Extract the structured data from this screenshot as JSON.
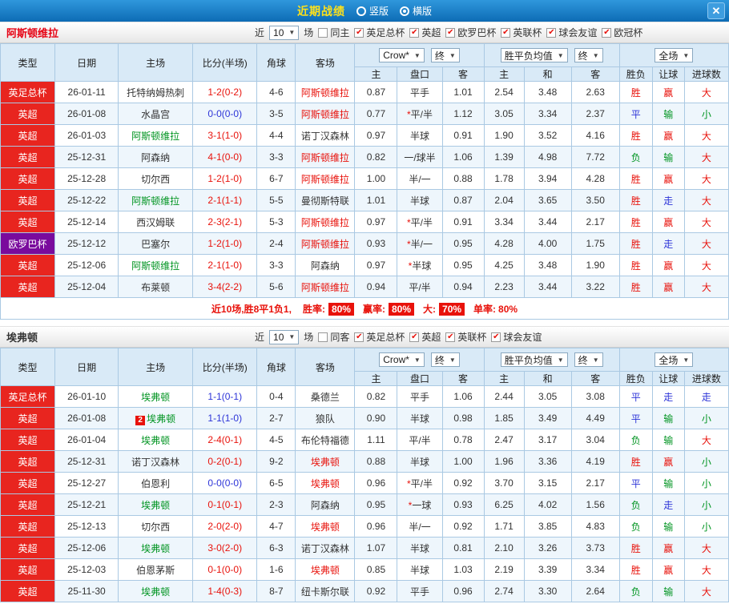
{
  "topbar": {
    "title": "近期战绩",
    "radios": [
      {
        "label": "竖版",
        "selected": false
      },
      {
        "label": "横版",
        "selected": true
      }
    ],
    "close_glyph": "✕"
  },
  "columns": {
    "main": [
      "类型",
      "日期",
      "主场",
      "比分(半场)",
      "角球",
      "客场"
    ],
    "sub": [
      "主",
      "盘口",
      "客",
      "主",
      "和",
      "客",
      "胜负",
      "让球",
      "进球数"
    ]
  },
  "odds_header": {
    "crown": "Crow*",
    "final": "终",
    "avg": "胜平负均值",
    "full": "全场"
  },
  "colors": {
    "red": "#e8120b",
    "green": "#009421",
    "blue": "#2d34d8",
    "black": "#333333",
    "league_red": "#e8251f",
    "league_purple": "#7a0b9d",
    "summary_red": "#e8120b",
    "check_red": "#e8120b",
    "header_blue_bg": "#d9eaf7",
    "topbar_blue": "#1a7fc4",
    "title_yellow": "#ffe11a"
  },
  "sections": [
    {
      "team": "阿斯顿维拉",
      "team_color": "#e60012",
      "filter": {
        "near_label": "近",
        "count": "10",
        "games_label": "场",
        "checkboxes": [
          {
            "label": "同主",
            "checked": false
          },
          {
            "label": "英足总杯",
            "checked": true
          },
          {
            "label": "英超",
            "checked": true
          },
          {
            "label": "欧罗巴杯",
            "checked": true
          },
          {
            "label": "英联杯",
            "checked": true
          },
          {
            "label": "球会友谊",
            "checked": true
          },
          {
            "label": "欧冠杯",
            "checked": true
          }
        ]
      },
      "rows": [
        {
          "league": "英足总杯",
          "league_bg": "red",
          "date": "26-01-11",
          "home": "托特纳姆热刺",
          "home_c": "black",
          "home_badge": "",
          "score": "1-2(0-2)",
          "score_c": "red",
          "corner": "4-6",
          "away": "阿斯顿维拉",
          "away_c": "red",
          "o1": "0.87",
          "hc": "平手",
          "o2": "1.01",
          "e1": "2.54",
          "e2": "3.48",
          "e3": "2.63",
          "r1": "胜",
          "r1c": "red",
          "r2": "赢",
          "r2c": "red",
          "r3": "大",
          "r3c": "red"
        },
        {
          "league": "英超",
          "league_bg": "red",
          "date": "26-01-08",
          "home": "水晶宫",
          "home_c": "black",
          "home_badge": "",
          "score": "0-0(0-0)",
          "score_c": "blue",
          "corner": "3-5",
          "away": "阿斯顿维拉",
          "away_c": "red",
          "o1": "0.77",
          "hc": "*平/半",
          "o2": "1.12",
          "e1": "3.05",
          "e2": "3.34",
          "e3": "2.37",
          "r1": "平",
          "r1c": "blue",
          "r2": "输",
          "r2c": "green",
          "r3": "小",
          "r3c": "green"
        },
        {
          "league": "英超",
          "league_bg": "red",
          "date": "26-01-03",
          "home": "阿斯顿维拉",
          "home_c": "green",
          "home_badge": "",
          "score": "3-1(1-0)",
          "score_c": "red",
          "corner": "4-4",
          "away": "诺丁汉森林",
          "away_c": "black",
          "o1": "0.97",
          "hc": "半球",
          "o2": "0.91",
          "e1": "1.90",
          "e2": "3.52",
          "e3": "4.16",
          "r1": "胜",
          "r1c": "red",
          "r2": "赢",
          "r2c": "red",
          "r3": "大",
          "r3c": "red"
        },
        {
          "league": "英超",
          "league_bg": "red",
          "date": "25-12-31",
          "home": "阿森纳",
          "home_c": "black",
          "home_badge": "",
          "score": "4-1(0-0)",
          "score_c": "red",
          "corner": "3-3",
          "away": "阿斯顿维拉",
          "away_c": "red",
          "o1": "0.82",
          "hc": "一/球半",
          "o2": "1.06",
          "e1": "1.39",
          "e2": "4.98",
          "e3": "7.72",
          "r1": "负",
          "r1c": "green",
          "r2": "输",
          "r2c": "green",
          "r3": "大",
          "r3c": "red"
        },
        {
          "league": "英超",
          "league_bg": "red",
          "date": "25-12-28",
          "home": "切尔西",
          "home_c": "black",
          "home_badge": "",
          "score": "1-2(1-0)",
          "score_c": "red",
          "corner": "6-7",
          "away": "阿斯顿维拉",
          "away_c": "red",
          "o1": "1.00",
          "hc": "半/一",
          "o2": "0.88",
          "e1": "1.78",
          "e2": "3.94",
          "e3": "4.28",
          "r1": "胜",
          "r1c": "red",
          "r2": "赢",
          "r2c": "red",
          "r3": "大",
          "r3c": "red"
        },
        {
          "league": "英超",
          "league_bg": "red",
          "date": "25-12-22",
          "home": "阿斯顿维拉",
          "home_c": "green",
          "home_badge": "",
          "score": "2-1(1-1)",
          "score_c": "red",
          "corner": "5-5",
          "away": "曼彻斯特联",
          "away_c": "black",
          "o1": "1.01",
          "hc": "半球",
          "o2": "0.87",
          "e1": "2.04",
          "e2": "3.65",
          "e3": "3.50",
          "r1": "胜",
          "r1c": "red",
          "r2": "走",
          "r2c": "blue",
          "r3": "大",
          "r3c": "red"
        },
        {
          "league": "英超",
          "league_bg": "red",
          "date": "25-12-14",
          "home": "西汉姆联",
          "home_c": "black",
          "home_badge": "",
          "score": "2-3(2-1)",
          "score_c": "red",
          "corner": "5-3",
          "away": "阿斯顿维拉",
          "away_c": "red",
          "o1": "0.97",
          "hc": "*平/半",
          "o2": "0.91",
          "e1": "3.34",
          "e2": "3.44",
          "e3": "2.17",
          "r1": "胜",
          "r1c": "red",
          "r2": "赢",
          "r2c": "red",
          "r3": "大",
          "r3c": "red"
        },
        {
          "league": "欧罗巴杯",
          "league_bg": "purple",
          "date": "25-12-12",
          "home": "巴塞尔",
          "home_c": "black",
          "home_badge": "",
          "score": "1-2(1-0)",
          "score_c": "red",
          "corner": "2-4",
          "away": "阿斯顿维拉",
          "away_c": "red",
          "o1": "0.93",
          "hc": "*半/一",
          "o2": "0.95",
          "e1": "4.28",
          "e2": "4.00",
          "e3": "1.75",
          "r1": "胜",
          "r1c": "red",
          "r2": "走",
          "r2c": "blue",
          "r3": "大",
          "r3c": "red"
        },
        {
          "league": "英超",
          "league_bg": "red",
          "date": "25-12-06",
          "home": "阿斯顿维拉",
          "home_c": "green",
          "home_badge": "",
          "score": "2-1(1-0)",
          "score_c": "red",
          "corner": "3-3",
          "away": "阿森纳",
          "away_c": "black",
          "o1": "0.97",
          "hc": "*半球",
          "o2": "0.95",
          "e1": "4.25",
          "e2": "3.48",
          "e3": "1.90",
          "r1": "胜",
          "r1c": "red",
          "r2": "赢",
          "r2c": "red",
          "r3": "大",
          "r3c": "red"
        },
        {
          "league": "英超",
          "league_bg": "red",
          "date": "25-12-04",
          "home": "布莱顿",
          "home_c": "black",
          "home_badge": "",
          "score": "3-4(2-2)",
          "score_c": "red",
          "corner": "5-6",
          "away": "阿斯顿维拉",
          "away_c": "red",
          "o1": "0.94",
          "hc": "平/半",
          "o2": "0.94",
          "e1": "2.23",
          "e2": "3.44",
          "e3": "3.22",
          "r1": "胜",
          "r1c": "red",
          "r2": "赢",
          "r2c": "red",
          "r3": "大",
          "r3c": "red"
        }
      ],
      "summary": {
        "prefix": "近10场,胜8平1负1,",
        "items": [
          {
            "label": "胜率:",
            "value": "80%",
            "boxed": true
          },
          {
            "label": "赢率:",
            "value": "80%",
            "boxed": true
          },
          {
            "label": "大:",
            "value": "70%",
            "boxed": true
          },
          {
            "label": "单率:",
            "value": "80%",
            "boxed": false
          }
        ]
      }
    },
    {
      "team": "埃弗顿",
      "team_color": "#333333",
      "filter": {
        "near_label": "近",
        "count": "10",
        "games_label": "场",
        "checkboxes": [
          {
            "label": "同客",
            "checked": false
          },
          {
            "label": "英足总杯",
            "checked": true
          },
          {
            "label": "英超",
            "checked": true
          },
          {
            "label": "英联杯",
            "checked": true
          },
          {
            "label": "球会友谊",
            "checked": true
          }
        ]
      },
      "rows": [
        {
          "league": "英足总杯",
          "league_bg": "red",
          "date": "26-01-10",
          "home": "埃弗顿",
          "home_c": "green",
          "home_badge": "",
          "score": "1-1(0-1)",
          "score_c": "blue",
          "corner": "0-4",
          "away": "桑德兰",
          "away_c": "black",
          "o1": "0.82",
          "hc": "平手",
          "o2": "1.06",
          "e1": "2.44",
          "e2": "3.05",
          "e3": "3.08",
          "r1": "平",
          "r1c": "blue",
          "r2": "走",
          "r2c": "blue",
          "r3": "走",
          "r3c": "blue"
        },
        {
          "league": "英超",
          "league_bg": "red",
          "date": "26-01-08",
          "home": "埃弗顿",
          "home_c": "green",
          "home_badge": "2",
          "score": "1-1(1-0)",
          "score_c": "blue",
          "corner": "2-7",
          "away": "狼队",
          "away_c": "black",
          "o1": "0.90",
          "hc": "半球",
          "o2": "0.98",
          "e1": "1.85",
          "e2": "3.49",
          "e3": "4.49",
          "r1": "平",
          "r1c": "blue",
          "r2": "输",
          "r2c": "green",
          "r3": "小",
          "r3c": "green"
        },
        {
          "league": "英超",
          "league_bg": "red",
          "date": "26-01-04",
          "home": "埃弗顿",
          "home_c": "green",
          "home_badge": "",
          "score": "2-4(0-1)",
          "score_c": "red",
          "corner": "4-5",
          "away": "布伦特福德",
          "away_c": "black",
          "o1": "1.11",
          "hc": "平/半",
          "o2": "0.78",
          "e1": "2.47",
          "e2": "3.17",
          "e3": "3.04",
          "r1": "负",
          "r1c": "green",
          "r2": "输",
          "r2c": "green",
          "r3": "大",
          "r3c": "red"
        },
        {
          "league": "英超",
          "league_bg": "red",
          "date": "25-12-31",
          "home": "诺丁汉森林",
          "home_c": "black",
          "home_badge": "",
          "score": "0-2(0-1)",
          "score_c": "red",
          "corner": "9-2",
          "away": "埃弗顿",
          "away_c": "red",
          "o1": "0.88",
          "hc": "半球",
          "o2": "1.00",
          "e1": "1.96",
          "e2": "3.36",
          "e3": "4.19",
          "r1": "胜",
          "r1c": "red",
          "r2": "赢",
          "r2c": "red",
          "r3": "小",
          "r3c": "green"
        },
        {
          "league": "英超",
          "league_bg": "red",
          "date": "25-12-27",
          "home": "伯恩利",
          "home_c": "black",
          "home_badge": "",
          "score": "0-0(0-0)",
          "score_c": "blue",
          "corner": "6-5",
          "away": "埃弗顿",
          "away_c": "red",
          "o1": "0.96",
          "hc": "*平/半",
          "o2": "0.92",
          "e1": "3.70",
          "e2": "3.15",
          "e3": "2.17",
          "r1": "平",
          "r1c": "blue",
          "r2": "输",
          "r2c": "green",
          "r3": "小",
          "r3c": "green"
        },
        {
          "league": "英超",
          "league_bg": "red",
          "date": "25-12-21",
          "home": "埃弗顿",
          "home_c": "green",
          "home_badge": "",
          "score": "0-1(0-1)",
          "score_c": "red",
          "corner": "2-3",
          "away": "阿森纳",
          "away_c": "black",
          "o1": "0.95",
          "hc": "*一球",
          "o2": "0.93",
          "e1": "6.25",
          "e2": "4.02",
          "e3": "1.56",
          "r1": "负",
          "r1c": "green",
          "r2": "走",
          "r2c": "blue",
          "r3": "小",
          "r3c": "green"
        },
        {
          "league": "英超",
          "league_bg": "red",
          "date": "25-12-13",
          "home": "切尔西",
          "home_c": "black",
          "home_badge": "",
          "score": "2-0(2-0)",
          "score_c": "red",
          "corner": "4-7",
          "away": "埃弗顿",
          "away_c": "red",
          "o1": "0.96",
          "hc": "半/一",
          "o2": "0.92",
          "e1": "1.71",
          "e2": "3.85",
          "e3": "4.83",
          "r1": "负",
          "r1c": "green",
          "r2": "输",
          "r2c": "green",
          "r3": "小",
          "r3c": "green"
        },
        {
          "league": "英超",
          "league_bg": "red",
          "date": "25-12-06",
          "home": "埃弗顿",
          "home_c": "green",
          "home_badge": "",
          "score": "3-0(2-0)",
          "score_c": "red",
          "corner": "6-3",
          "away": "诺丁汉森林",
          "away_c": "black",
          "o1": "1.07",
          "hc": "半球",
          "o2": "0.81",
          "e1": "2.10",
          "e2": "3.26",
          "e3": "3.73",
          "r1": "胜",
          "r1c": "red",
          "r2": "赢",
          "r2c": "red",
          "r3": "大",
          "r3c": "red"
        },
        {
          "league": "英超",
          "league_bg": "red",
          "date": "25-12-03",
          "home": "伯恩茅斯",
          "home_c": "black",
          "home_badge": "",
          "score": "0-1(0-0)",
          "score_c": "red",
          "corner": "1-6",
          "away": "埃弗顿",
          "away_c": "red",
          "o1": "0.85",
          "hc": "半球",
          "o2": "1.03",
          "e1": "2.19",
          "e2": "3.39",
          "e3": "3.34",
          "r1": "胜",
          "r1c": "red",
          "r2": "赢",
          "r2c": "red",
          "r3": "大",
          "r3c": "red"
        },
        {
          "league": "英超",
          "league_bg": "red",
          "date": "25-11-30",
          "home": "埃弗顿",
          "home_c": "green",
          "home_badge": "",
          "score": "1-4(0-3)",
          "score_c": "red",
          "corner": "8-7",
          "away": "纽卡斯尔联",
          "away_c": "black",
          "o1": "0.92",
          "hc": "平手",
          "o2": "0.96",
          "e1": "2.74",
          "e2": "3.30",
          "e3": "2.64",
          "r1": "负",
          "r1c": "green",
          "r2": "输",
          "r2c": "green",
          "r3": "大",
          "r3c": "red"
        }
      ],
      "summary": null
    }
  ]
}
